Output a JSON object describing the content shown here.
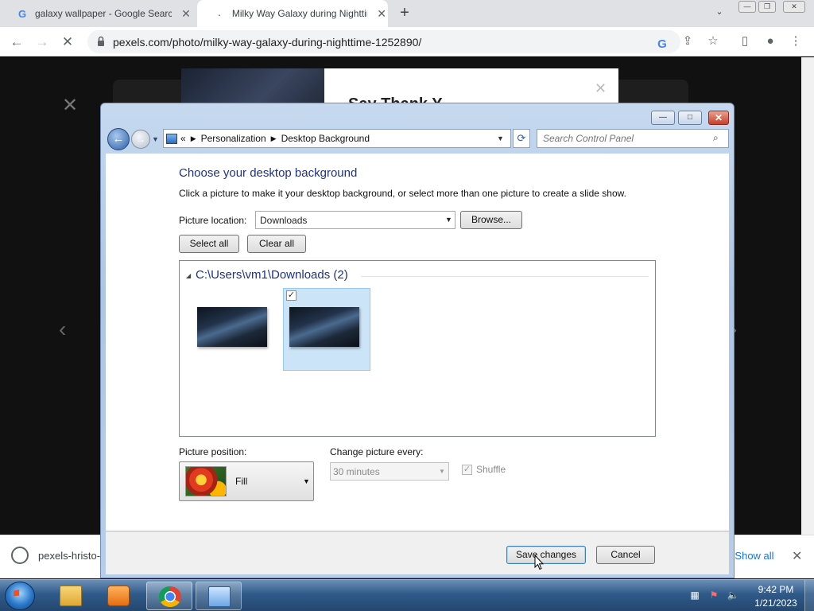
{
  "browser": {
    "tabs": [
      {
        "title": "galaxy wallpaper - Google Search",
        "favicon": "G"
      },
      {
        "title": "Milky Way Galaxy during Nighttime",
        "favicon": "."
      }
    ],
    "url": "pexels.com/photo/milky-way-galaxy-during-nighttime-1252890/",
    "page": {
      "modal_heading": "Say Thank Y"
    },
    "download": {
      "filename": "pexels-hristo-",
      "show_all": "Show all"
    }
  },
  "dialog": {
    "breadcrumb": [
      "Personalization",
      "Desktop Background"
    ],
    "breadcrumb_prefix": "«",
    "search_placeholder": "Search Control Panel",
    "title": "Choose your desktop background",
    "description": "Click a picture to make it your desktop background, or select more than one picture to create a slide show.",
    "picture_location_label": "Picture location:",
    "picture_location_value": "Downloads",
    "browse_label": "Browse...",
    "select_all_label": "Select all",
    "clear_all_label": "Clear all",
    "group_title": "C:\\Users\\vm1\\Downloads (2)",
    "thumbnails": [
      {
        "selected": false
      },
      {
        "selected": true
      }
    ],
    "picture_position_label": "Picture position:",
    "picture_position_value": "Fill",
    "change_every_label": "Change picture every:",
    "change_every_value": "30 minutes",
    "shuffle_label": "Shuffle",
    "shuffle_checked": true,
    "save_label": "Save changes",
    "cancel_label": "Cancel"
  },
  "taskbar": {
    "time": "9:42 PM",
    "date": "1/21/2023"
  }
}
